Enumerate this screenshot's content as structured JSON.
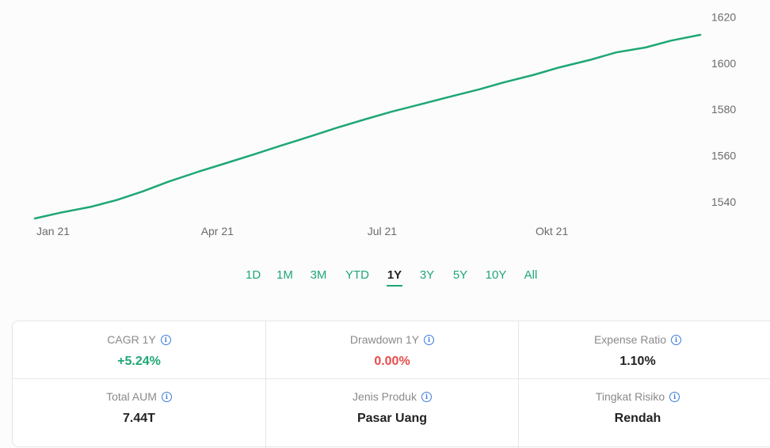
{
  "chart_data": {
    "type": "line",
    "x_ticks": [
      "Jan 21",
      "Apr 21",
      "Jul 21",
      "Okt 21"
    ],
    "y_ticks": [
      1540,
      1560,
      1580,
      1600,
      1620
    ],
    "ylim": [
      1528,
      1626
    ],
    "series": [
      {
        "color": "#1ea774",
        "x": [
          "2021-01-01",
          "2021-01-15",
          "2021-02-01",
          "2021-02-15",
          "2021-03-01",
          "2021-03-15",
          "2021-04-01",
          "2021-04-15",
          "2021-05-01",
          "2021-05-15",
          "2021-06-01",
          "2021-06-15",
          "2021-07-01",
          "2021-07-15",
          "2021-08-01",
          "2021-08-15",
          "2021-09-01",
          "2021-09-15",
          "2021-10-01",
          "2021-10-15",
          "2021-11-01",
          "2021-11-15",
          "2021-12-01",
          "2021-12-15",
          "2021-12-31"
        ],
        "y": [
          1532.8,
          1535.3,
          1537.9,
          1540.8,
          1544.5,
          1548.7,
          1553.2,
          1556.6,
          1560.6,
          1564.2,
          1568.4,
          1572.0,
          1575.8,
          1579.0,
          1582.4,
          1585.3,
          1588.7,
          1591.8,
          1595.0,
          1598.2,
          1601.5,
          1604.7,
          1606.8,
          1609.8,
          1612.3
        ]
      }
    ],
    "grid": false
  },
  "periods": {
    "items": [
      "1D",
      "1M",
      "3M",
      "YTD",
      "1Y",
      "3Y",
      "5Y",
      "10Y",
      "All"
    ],
    "active": "1Y"
  },
  "stats": [
    {
      "label": "CAGR 1Y",
      "value": "+5.24%",
      "color": "#1ea774"
    },
    {
      "label": "Drawdown 1Y",
      "value": "0.00%",
      "color": "#e74c4c"
    },
    {
      "label": "Expense Ratio",
      "value": "1.10%",
      "color": "#222222"
    },
    {
      "label": "Total AUM",
      "value": "7.44T",
      "color": "#222222"
    },
    {
      "label": "Jenis Produk",
      "value": "Pasar Uang",
      "color": "#222222"
    },
    {
      "label": "Tingkat Risiko",
      "value": "Rendah",
      "color": "#222222"
    }
  ],
  "info_icon": "info-icon"
}
